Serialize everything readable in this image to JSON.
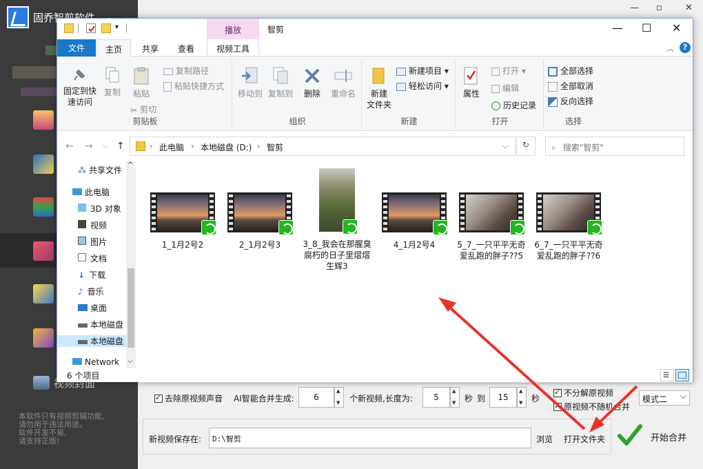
{
  "app": {
    "title": "固乔智剪软件",
    "sidebar_bottom_label": "视频封面",
    "note_lines": [
      "本软件只有视频剪辑功能,",
      "请勿用于违法用途。",
      "软件开发不易,",
      "请支持正版!"
    ]
  },
  "merge_options": {
    "remove_audio_label": "去除原视频声音",
    "ai_merge_prefix": "AI智能合并生成:",
    "count_value": "6",
    "new_videos_length_label": "个新视频,长度为:",
    "len_min": "5",
    "sec_label": "秒",
    "to_label": "到",
    "len_max": "15",
    "sec_label2": "秒",
    "no_decompose_label": "不分解原视频",
    "no_random_label": "原视频不随机合并",
    "mode_value": "模式二"
  },
  "save": {
    "label": "新视频保存在:",
    "path": "D:\\智剪",
    "browse": "浏览",
    "open_folder": "打开文件夹",
    "start": "开始合并"
  },
  "explorer": {
    "contextual_tab": "播放",
    "window_title": "智剪",
    "tabs": [
      "文件",
      "主页",
      "共享",
      "查看",
      "视频工具"
    ],
    "clipboard": {
      "pin": [
        "固定到快",
        "速访问"
      ],
      "copy": "复制",
      "paste": "粘贴",
      "copy_path": "复制路径",
      "paste_shortcut": "粘贴快捷方式",
      "cut": "剪切",
      "group": "剪贴板"
    },
    "organize": {
      "move_to": "移动到",
      "copy_to": "复制到",
      "delete": "删除",
      "rename": "重命名",
      "group": "组织"
    },
    "new_group": {
      "new_item": "新建项目",
      "easy_access": "轻松访问",
      "new_folder": [
        "新建",
        "文件夹"
      ],
      "group": "新建"
    },
    "open_group": {
      "properties": "属性",
      "open": "打开",
      "edit": "编辑",
      "history": "历史记录",
      "group": "打开"
    },
    "select_group": {
      "select_all": "全部选择",
      "select_none": "全部取消",
      "invert": "反向选择",
      "group": "选择"
    },
    "breadcrumb": [
      "此电脑",
      "本地磁盘 (D:)",
      "智剪"
    ],
    "search_placeholder": "搜索\"智剪\"",
    "nav": [
      "共享文件",
      "此电脑",
      "3D 对象",
      "视频",
      "图片",
      "文档",
      "下载",
      "音乐",
      "桌面",
      "本地磁盘",
      "本地磁盘",
      "Network"
    ],
    "files": [
      {
        "name": "1_1月2号2"
      },
      {
        "name": "2_1月2号3"
      },
      {
        "name": "3_8_我会在那腥臭腐朽的日子里熠熠生辉3"
      },
      {
        "name": "4_1月2号4"
      },
      {
        "name": "5_7_一只平平无奇爱乱跑的胖子??5"
      },
      {
        "name": "6_7_一只平平无奇爱乱跑的胖子??6"
      }
    ],
    "status": "6 个项目"
  },
  "colors": {
    "accent_blue": "#1979ca",
    "arrow_red": "#e8332a",
    "play_tab_bg": "#f7d9f2",
    "sidebar_bg": "#3b3b3b"
  }
}
